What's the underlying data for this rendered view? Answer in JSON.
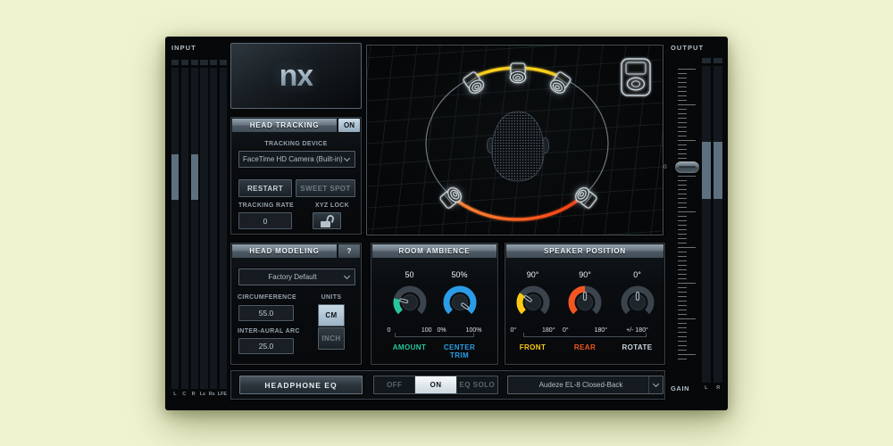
{
  "plugin": {
    "logo": "nx"
  },
  "input": {
    "label": "INPUT",
    "channels": [
      "L",
      "C",
      "R",
      "Ls",
      "Rs",
      "LFE"
    ],
    "levels": [
      [
        0.27,
        0.41
      ],
      [
        0,
        0
      ],
      [
        0.27,
        0.41
      ],
      [
        0,
        0
      ],
      [
        0,
        0
      ],
      [
        0,
        0
      ]
    ]
  },
  "output": {
    "label": "OUTPUT",
    "gain_label": "GAIN",
    "channels": [
      "L",
      "R"
    ],
    "levels": [
      [
        0.24,
        0.42
      ],
      [
        0.24,
        0.42
      ]
    ],
    "fader_value": "0"
  },
  "head_tracking": {
    "title": "HEAD TRACKING",
    "power": "ON",
    "tracking_device_label": "TRACKING DEVICE",
    "tracking_device": "FaceTime HD Camera (Built-in)",
    "restart_label": "RESTART",
    "sweet_spot_label": "SWEET SPOT",
    "tracking_rate_label": "TRACKING RATE",
    "tracking_rate": "0",
    "xyz_lock_label": "XYZ LOCK"
  },
  "head_modeling": {
    "title": "HEAD MODELING",
    "help_label": "?",
    "preset": "Factory Default",
    "circumference_label": "CIRCUMFERENCE",
    "circumference": "55.0",
    "units_label": "UNITS",
    "unit_options": [
      "CM",
      "INCH"
    ],
    "selected_unit": "CM",
    "inter_aural_arc_label": "INTER-AURAL ARC",
    "inter_aural_arc": "25.0"
  },
  "room_ambience": {
    "title": "ROOM AMBIENCE",
    "knobs": [
      {
        "name": "AMOUNT",
        "value": "50",
        "min": "0",
        "max": "100",
        "color": "#28c79e",
        "fill": 0.22,
        "pointer": 0.22
      },
      {
        "name": "CENTER TRIM",
        "value": "50%",
        "min": "0%",
        "max": "100%",
        "color": "#2b9de8",
        "fill": 1,
        "pointer": 0.97
      }
    ]
  },
  "speaker_position": {
    "title": "SPEAKER POSITION",
    "knobs": [
      {
        "name": "FRONT",
        "value": "90°",
        "min": "0°",
        "max": "180°",
        "color": "#fcca12",
        "fill": 0.3,
        "pointer": 0.3
      },
      {
        "name": "REAR",
        "value": "90°",
        "min": "0°",
        "max": "180°",
        "color": "#f5561f",
        "fill": 0.5,
        "pointer": 0.5
      },
      {
        "name": "ROTATE",
        "value": "0°",
        "min": "+/- 180°",
        "max": "",
        "color": "#ccd6dd",
        "fill": 0,
        "pointer": 0.5
      }
    ]
  },
  "headphone_eq": {
    "title": "HEADPHONE EQ",
    "modes": [
      "OFF",
      "ON",
      "EQ SOLO"
    ],
    "active_mode": "ON",
    "preset": "Audeze EL-8 Closed-Back"
  },
  "display": {
    "front_arc_color": "#ffd21a",
    "rear_arc_start": "#ff8a36",
    "rear_arc_end": "#ff3c12",
    "speaker_count": 5
  }
}
